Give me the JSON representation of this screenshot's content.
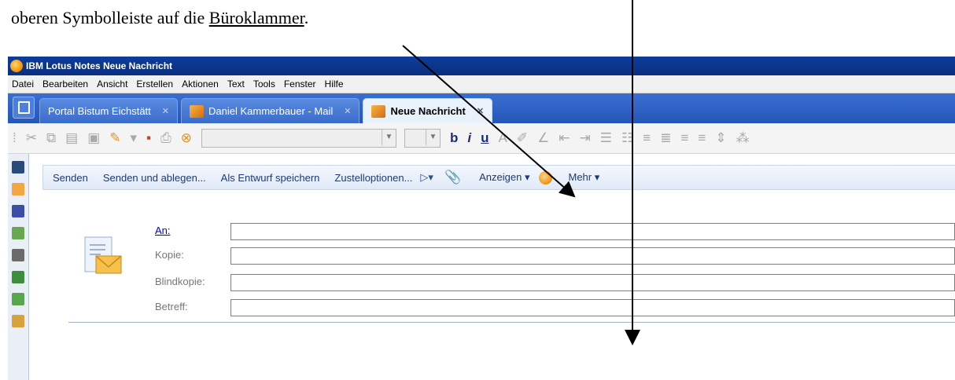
{
  "doc": {
    "text_before": "oberen Symbolleiste auf die ",
    "underlined": "Büroklammer",
    "text_after": "."
  },
  "window": {
    "title": "IBM Lotus Notes Neue Nachricht"
  },
  "menu": {
    "items": [
      "Datei",
      "Bearbeiten",
      "Ansicht",
      "Erstellen",
      "Aktionen",
      "Text",
      "Tools",
      "Fenster",
      "Hilfe"
    ]
  },
  "tabs": [
    {
      "label": "Portal Bistum Eichstätt",
      "close": "✕",
      "icon": ""
    },
    {
      "label": "Daniel Kammerbauer - Mail",
      "close": "✕",
      "icon": "mail-folder-icon"
    },
    {
      "label": "Neue Nachricht",
      "close": "✕",
      "icon": "new-message-icon"
    }
  ],
  "actions": {
    "senden": "Senden",
    "senden_ablegen": "Senden und ablegen...",
    "entwurf": "Als Entwurf speichern",
    "zustell": "Zustelloptionen...",
    "anzeigen": "Anzeigen",
    "mehr": "Mehr"
  },
  "form": {
    "an_label": "An:",
    "kopie_label": "Kopie:",
    "blind_label": "Blindkopie:",
    "betreff_label": "Betreff:",
    "an_value": "",
    "kopie_value": "",
    "blind_value": "",
    "betreff_value": ""
  },
  "colors": {
    "titlebar": "#0a2f80",
    "tabbar": "#2456b8",
    "active_tab": "#e9f1fb",
    "link": "#0000cc"
  }
}
